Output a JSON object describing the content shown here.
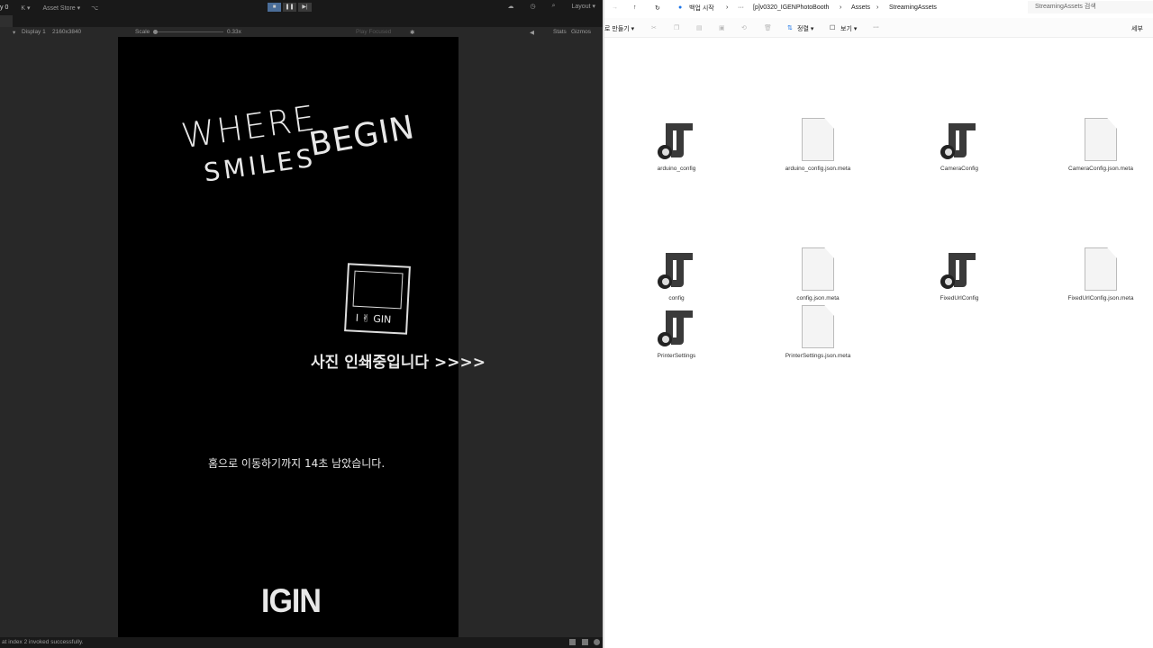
{
  "unity": {
    "toolbar": {
      "account": "y 0",
      "user": "K ▾",
      "asset_store": "Asset Store ▾",
      "layout": "Layout ▾"
    },
    "play_controls": {
      "play": "■",
      "pause": "❚❚",
      "step": "▶|"
    },
    "game_toolbar": {
      "display": "Display 1",
      "resolution": "2160x3840",
      "scale_label": "Scale",
      "scale_value": "0.33x",
      "play_mode": "Play Focused",
      "stats": "Stats",
      "gizmos": "Gizmos"
    },
    "scale_fraction": 0.0,
    "game": {
      "title_line1": "WHERE",
      "title_line1b": "BEGIN",
      "title_line2": "SMILES",
      "sticker_text": "I ✌ GIN",
      "printing": "사진 인쇄중입니다 >>>>",
      "countdown": "홈으로 이동하기까지 14초 남았습니다.",
      "logo": "IGIN"
    },
    "status": "at index 2 invoked successfully."
  },
  "explorer": {
    "address": {
      "root": "백업 시작",
      "ellipsis": "···",
      "path": [
        "[p]v0320_IGENPhotoBooth",
        "Assets",
        "StreamingAssets"
      ]
    },
    "search_placeholder": "StreamingAssets 검색",
    "commands": {
      "new": "로 만들기 ▾",
      "sort": "정렬 ▾",
      "view": "보기 ▾",
      "more": "···",
      "details": "세부"
    },
    "files": [
      {
        "name": "arduino_config",
        "type": "json"
      },
      {
        "name": "arduino_config.json.meta",
        "type": "doc"
      },
      {
        "name": "CameraConfig",
        "type": "json"
      },
      {
        "name": "CameraConfig.json.meta",
        "type": "doc"
      },
      {
        "name": "config",
        "type": "json"
      },
      {
        "name": "config.json.meta",
        "type": "doc"
      },
      {
        "name": "FixedUrlConfig",
        "type": "json"
      },
      {
        "name": "FixedUrlConfig.json.meta",
        "type": "doc"
      },
      {
        "name": "PrinterSettings",
        "type": "json"
      },
      {
        "name": "PrinterSettings.json.meta",
        "type": "doc"
      }
    ]
  }
}
